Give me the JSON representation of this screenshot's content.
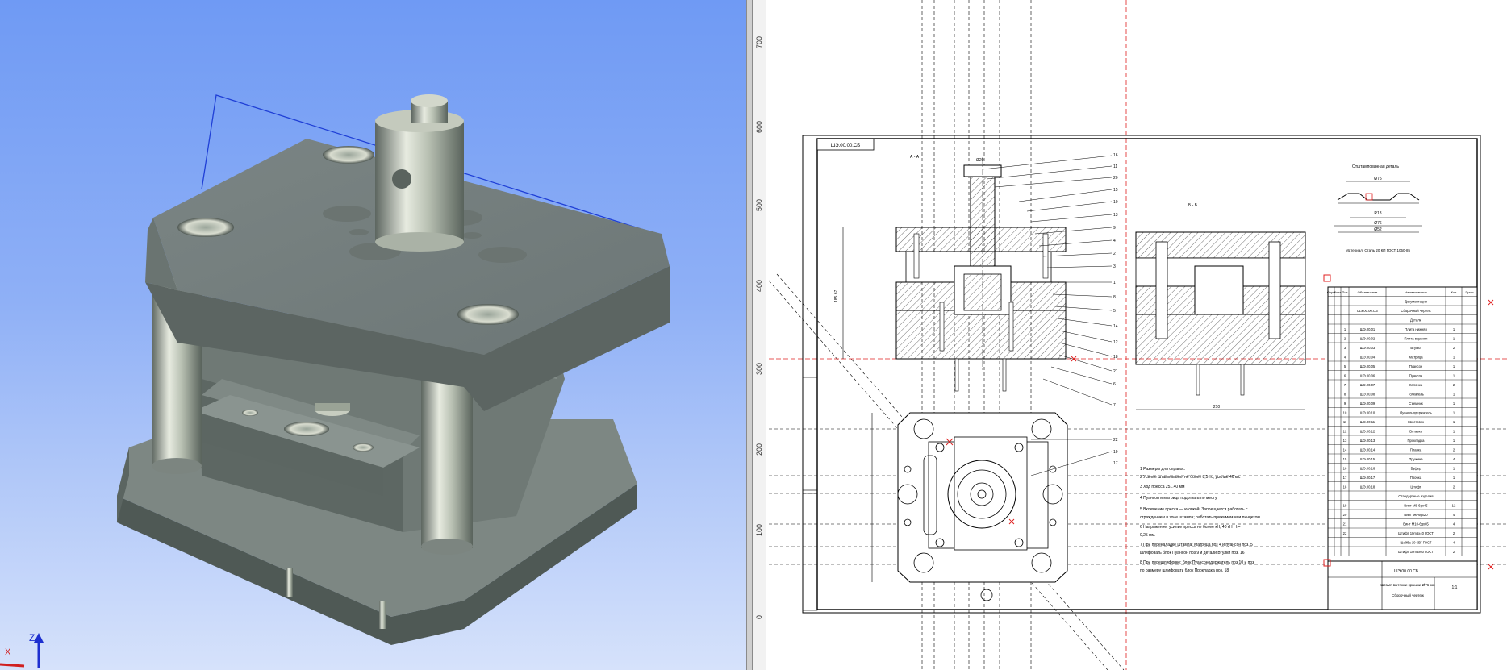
{
  "window": {
    "panes": [
      "3d-model-view",
      "drawing-sheet-view"
    ]
  },
  "axis_triad": {
    "z_label": "Z",
    "x_label": "X"
  },
  "ruler": {
    "ticks": [
      "700",
      "600",
      "500",
      "400",
      "300",
      "200",
      "100",
      "0"
    ]
  },
  "drawing": {
    "stamp_top_left": "ШЭ.00.00.СБ",
    "section_label_left": "А - А",
    "section_label_right": "Б - Б",
    "detail_title": "Отштампованная деталь",
    "material_note": "Материал: Сталь 20 КП ГОСТ 1050-85",
    "dims": {
      "d1": "Ø75",
      "d2": "Ø58",
      "d3": "Ø52",
      "d4": "R18",
      "d5": "Ø76",
      "height": "185 h7",
      "width": "210",
      "d_top": "Ø20"
    },
    "notes": [
      "1 Размеры для справок.",
      "2 Усилие штампования не более 8,5 тс; усилие 46 кгс",
      "3 Ход пресса 25...40 мм",
      "4 Пуансон и матрица подогнать по месту",
      "5 Включение пресса — кнопкой. Запрещается работать с",
      "  ограждением в зоне штампа; работать прижимом или пинцетом.",
      "6 Напряжение: усилие пресса не более кН, 40 кН ; h=",
      "  0,25 мм.",
      "7 При переналадке штампа: Матрица поз 4 и пуансон поз. 5",
      "  шлифовать блок Пуансон поз 9 и детали Втулки поз. 16",
      "8 При перешлифовке: блок Пуансонодержатель поз 10 и поз",
      "  по размеру шлифовать блок Прокладка поз. 18"
    ],
    "leaders": [
      "16",
      "11",
      "20",
      "15",
      "10",
      "13",
      "9",
      "4",
      "2",
      "3",
      "1",
      "8",
      "5",
      "14",
      "12",
      "18",
      "21",
      "6",
      "7",
      "22",
      "19",
      "17"
    ],
    "spec_table": {
      "headers": [
        "Форм",
        "Зона",
        "Поз",
        "Обозначение",
        "Наименование",
        "Кол",
        "Прим"
      ],
      "rows": [
        [
          "",
          "",
          "",
          "",
          "Документация",
          "",
          ""
        ],
        [
          "",
          "",
          "",
          "ШЭ.00.00.СБ",
          "Сборочный чертеж",
          "",
          ""
        ],
        [
          "",
          "",
          "",
          "",
          "Детали",
          "",
          ""
        ],
        [
          "",
          "",
          "1",
          "ШЭ.00.01",
          "Плита нижняя",
          "1",
          ""
        ],
        [
          "",
          "",
          "2",
          "ШЭ.00.02",
          "Плита верхняя",
          "1",
          ""
        ],
        [
          "",
          "",
          "3",
          "ШЭ.00.03",
          "Втулка",
          "2",
          ""
        ],
        [
          "",
          "",
          "4",
          "ШЭ.00.04",
          "Матрица",
          "1",
          ""
        ],
        [
          "",
          "",
          "5",
          "ШЭ.00.05",
          "Пуансон",
          "1",
          ""
        ],
        [
          "",
          "",
          "6",
          "ШЭ.00.06",
          "Пуансон",
          "1",
          ""
        ],
        [
          "",
          "",
          "7",
          "ШЭ.00.07",
          "Колонка",
          "2",
          ""
        ],
        [
          "",
          "",
          "8",
          "ШЭ.00.08",
          "Толкатель",
          "1",
          ""
        ],
        [
          "",
          "",
          "9",
          "ШЭ.00.09",
          "Съемник",
          "1",
          ""
        ],
        [
          "",
          "",
          "10",
          "ШЭ.00.10",
          "Пуансонодержатель",
          "1",
          ""
        ],
        [
          "",
          "",
          "11",
          "ШЭ.00.11",
          "Хвостовик",
          "1",
          ""
        ],
        [
          "",
          "",
          "12",
          "ШЭ.00.12",
          "Вставка",
          "1",
          ""
        ],
        [
          "",
          "",
          "13",
          "ШЭ.00.13",
          "Прокладка",
          "1",
          ""
        ],
        [
          "",
          "",
          "14",
          "ШЭ.00.14",
          "Планка",
          "2",
          ""
        ],
        [
          "",
          "",
          "15",
          "ШЭ.00.15",
          "Пружина",
          "4",
          ""
        ],
        [
          "",
          "",
          "16",
          "ШЭ.00.16",
          "Буфер",
          "1",
          ""
        ],
        [
          "",
          "",
          "17",
          "ШЭ.00.17",
          "Пробка",
          "1",
          ""
        ],
        [
          "",
          "",
          "18",
          "ШЭ.00.18",
          "Штифт",
          "2",
          ""
        ],
        [
          "",
          "",
          "",
          "",
          "Стандартные изделия",
          "",
          ""
        ],
        [
          "",
          "",
          "19",
          "",
          "Винт М8-6gx45",
          "12",
          ""
        ],
        [
          "",
          "",
          "20",
          "",
          "Винт М6-6gx20",
          "4",
          ""
        ],
        [
          "",
          "",
          "21",
          "",
          "Винт М10-6gx65",
          "4",
          ""
        ],
        [
          "",
          "",
          "22",
          "",
          "Штифт 10m6x40 ГОСТ",
          "2",
          ""
        ],
        [
          "",
          "",
          "",
          "",
          "Шайба 10 65Г ГОСТ",
          "4",
          ""
        ],
        [
          "",
          "",
          "",
          "",
          "Штифт 10m6x60 ГОСТ",
          "2",
          ""
        ]
      ]
    },
    "title_block": {
      "code": "ШЭ.00.00.СБ",
      "name": "Штамп вытяжки крышки Ø76 мм",
      "sub": "Сборочный чертеж",
      "scale": "1:1"
    }
  }
}
